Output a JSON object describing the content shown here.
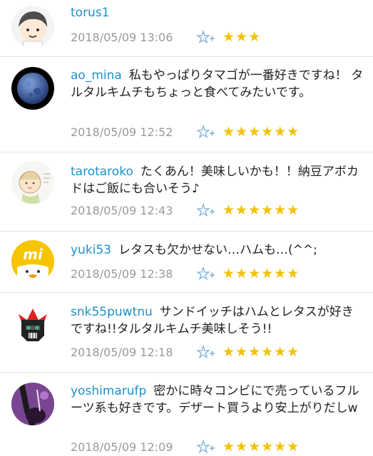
{
  "comments": [
    {
      "user": "torus1",
      "text": "",
      "time": "2018/05/09 13:06",
      "stars": "★★★"
    },
    {
      "user": "ao_mina",
      "text": "私もやっぱりタマゴが一番好きですね！ タルタルキムチもちょっと食べてみたいです。",
      "time": "2018/05/09 12:52",
      "stars": "★★★★★★"
    },
    {
      "user": "tarotaroko",
      "text": "たくあん！美味しいかも！！納豆アボカドはご飯にも合いそう♪",
      "time": "2018/05/09 12:43",
      "stars": "★★★★★★"
    },
    {
      "user": "yuki53",
      "text": "レタスも欠かせない…ハムも…(^^;",
      "time": "2018/05/09 12:38",
      "stars": "★★★★★★"
    },
    {
      "user": "snk55puwtnu",
      "text": "サンドイッチはハムとレタスが好きですね!!タルタルキムチ美味しそう!!",
      "time": "2018/05/09 12:18",
      "stars": "★★★★★★"
    },
    {
      "user": "yoshimarufp",
      "text": "密かに時々コンビにで売っているフルーツ系も好きです。デザート買うより安上がりだしw",
      "time": "2018/05/09 12:09",
      "stars": "★★★★★★"
    }
  ],
  "avatar_mi_label": "mi",
  "avatar_icons": [
    "cartoon-boy-icon",
    "moon-icon",
    "baby-drawing-icon",
    "mi-chick-icon",
    "robot-helmet-icon",
    "guitar-photo-icon"
  ],
  "colors": {
    "username": "#1e90c8",
    "star": "#f2c200",
    "timestamp": "#9a9a9a",
    "add_star": "#7fb0d8"
  }
}
